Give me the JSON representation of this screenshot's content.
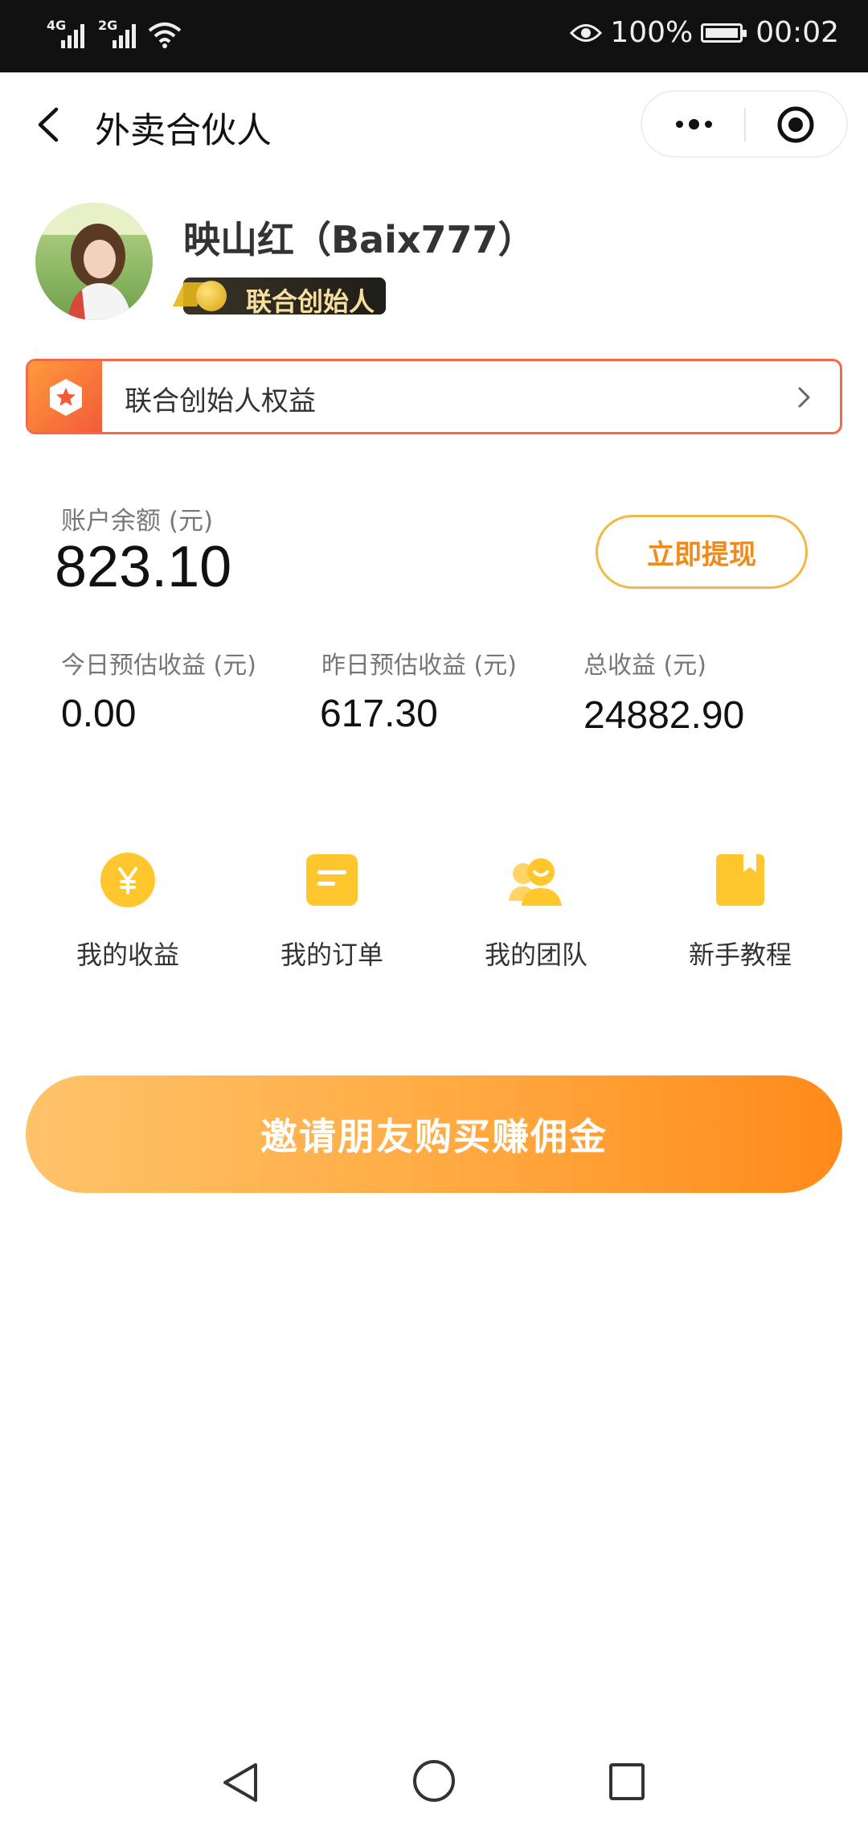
{
  "status_bar": {
    "signal_1": "4G",
    "signal_2": "2G",
    "battery": "100%",
    "time": "00:02",
    "icons": [
      "signal-icon",
      "wifi-icon",
      "eye-icon",
      "battery-icon"
    ]
  },
  "nav": {
    "title": "外卖合伙人",
    "icons": [
      "back-arrow-icon",
      "more-icon",
      "target-icon"
    ]
  },
  "profile": {
    "name": "映山红（Baix777）",
    "badge": "联合创始人"
  },
  "rights": {
    "label": "联合创始人权益"
  },
  "balance": {
    "label": "账户余额 (元)",
    "value": "823.10",
    "withdraw_label": "立即提现"
  },
  "stats": [
    {
      "label": "今日预估收益 (元)",
      "value": "0.00"
    },
    {
      "label": "昨日预估收益 (元)",
      "value": "617.30"
    },
    {
      "label": "总收益 (元)",
      "value": "24882.90"
    }
  ],
  "menu": [
    {
      "label": "我的收益",
      "icon": "yen-coin-icon"
    },
    {
      "label": "我的订单",
      "icon": "order-icon"
    },
    {
      "label": "我的团队",
      "icon": "team-icon"
    },
    {
      "label": "新手教程",
      "icon": "tutorial-icon"
    }
  ],
  "invite": {
    "label": "邀请朋友购买赚佣金"
  },
  "colors": {
    "accent": "#f08b1a",
    "icon_yellow": "#ffc62e",
    "border_red": "#f06a4a"
  }
}
